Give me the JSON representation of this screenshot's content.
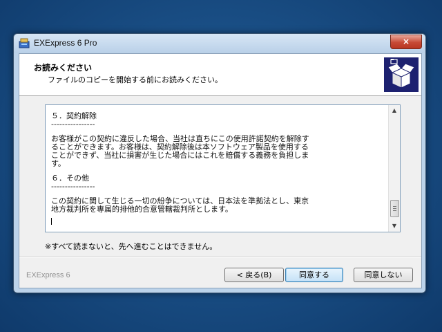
{
  "window": {
    "title": "EXExpress 6 Pro",
    "close_label": "×"
  },
  "header": {
    "title": "お読みください",
    "subtitle": "ファイルのコピーを開始する前にお読みください。"
  },
  "content": {
    "lines": [
      "５．契約解除",
      "----------------",
      "",
      "お客様がこの契約に違反した場合、当社は直ちにこの使用許諾契約を解除す",
      "ることができます。お客様は、契約解除後は本ソフトウェア製品を使用する",
      "ことができず、当社に損害が生じた場合にはこれを賠償する義務を負担しま",
      "す。",
      "",
      "６．その他",
      "----------------",
      "",
      "この契約に関して生じる一切の紛争については、日本法を準拠法とし、東京",
      "地方裁判所を専属的排他的合意管轄裁判所とします。"
    ]
  },
  "notice": "※すべて読まないと、先へ進むことはできません。",
  "footer": {
    "brand": "EXExpress 6",
    "back_label": "< 戻る(B)",
    "agree_label": "同意する",
    "disagree_label": "同意しない"
  },
  "colors": {
    "header_icon_bg": "#1d2170",
    "close_button": "#c74a36"
  }
}
